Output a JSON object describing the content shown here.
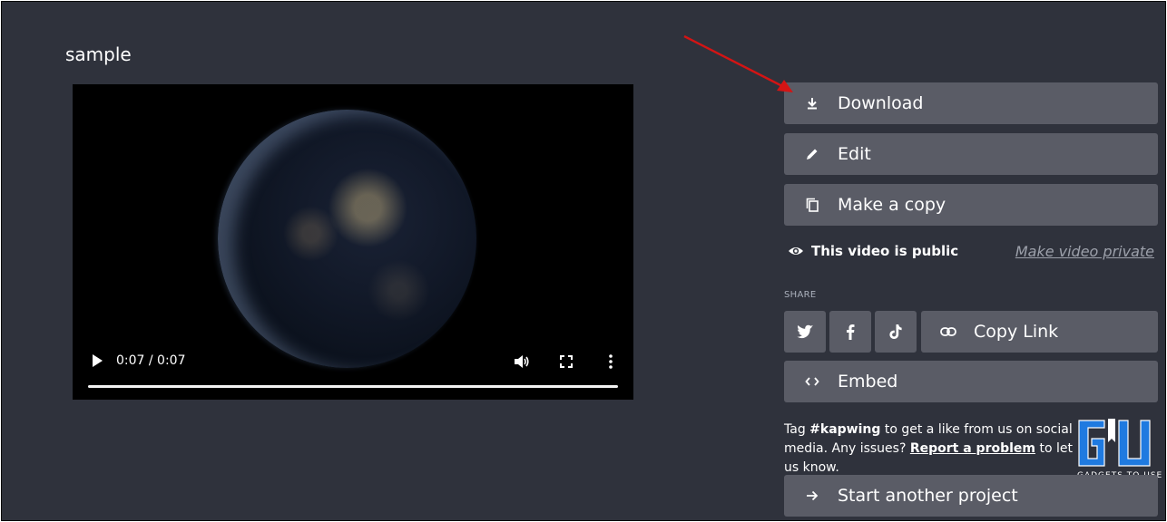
{
  "project": {
    "title": "sample"
  },
  "video": {
    "time": "0:07 / 0:07",
    "progress_fraction": 1.0
  },
  "actions": {
    "download": "Download",
    "edit": "Edit",
    "make_copy": "Make a copy",
    "embed": "Embed",
    "start_another": "Start another project"
  },
  "visibility": {
    "status": "This video is public",
    "toggle": "Make video private"
  },
  "share": {
    "label": "SHARE",
    "copy_link": "Copy Link",
    "buttons": [
      "twitter-icon",
      "facebook-icon",
      "tiktok-icon"
    ]
  },
  "tag_note": {
    "pre": "Tag ",
    "hashtag": "#kapwing",
    "mid": " to get a like from us on social media. Any issues? ",
    "report_link": "Report a problem",
    "post": " to let us know."
  },
  "watermark": {
    "caption": "GADGETS TO USE"
  },
  "colors": {
    "page_bg": "#2f323c",
    "button_bg": "#5a5c66",
    "annotation_arrow": "#d41414",
    "watermark_blue": "#1f7ae0"
  }
}
